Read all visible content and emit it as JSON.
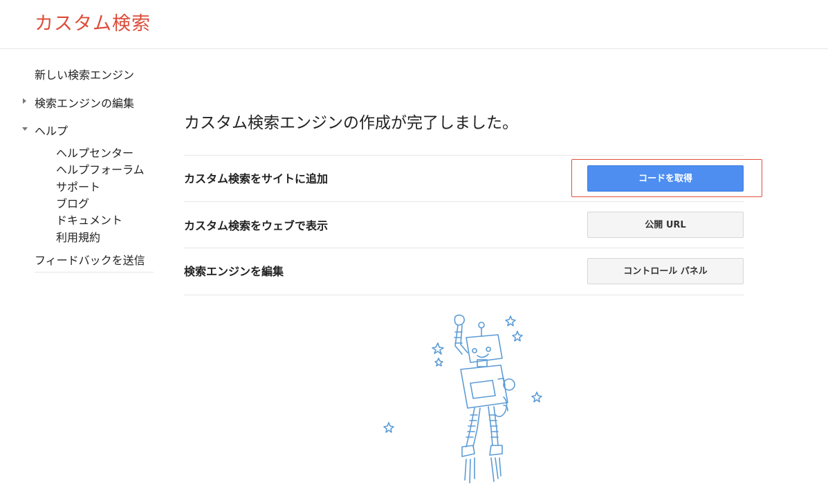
{
  "header": {
    "title": "カスタム検索"
  },
  "sidebar": {
    "new_engine": "新しい検索エンジン",
    "edit_engine": "検索エンジンの編集",
    "help": "ヘルプ",
    "help_items": [
      "ヘルプセンター",
      "ヘルプフォーラム",
      "サポート",
      "ブログ",
      "ドキュメント",
      "利用規約"
    ],
    "feedback": "フィードバックを送信"
  },
  "main": {
    "title": "カスタム検索エンジンの作成が完了しました。",
    "rows": [
      {
        "label": "カスタム検索をサイトに追加",
        "button": "コードを取得"
      },
      {
        "label": "カスタム検索をウェブで表示",
        "button": "公開 URL"
      },
      {
        "label": "検索エンジンを編集",
        "button": "コントロール パネル"
      }
    ]
  },
  "colors": {
    "title_red": "#dd4b39",
    "primary_blue": "#4d8ef0",
    "highlight_border": "#e04c3c",
    "robot_blue": "#5b9bd5"
  }
}
